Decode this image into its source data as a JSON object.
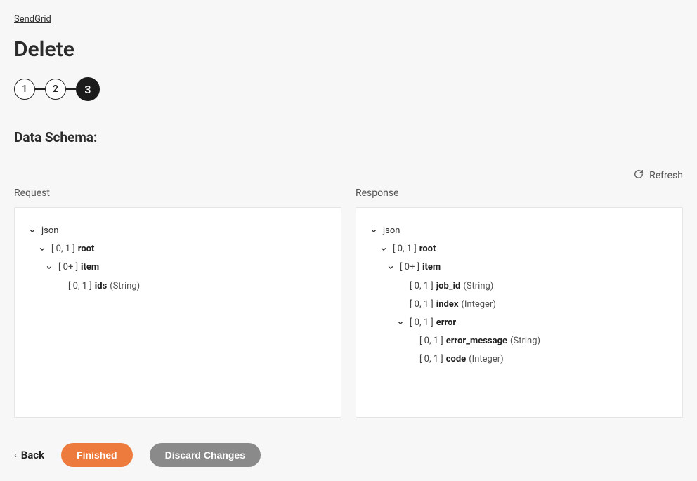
{
  "breadcrumb": {
    "label": "SendGrid"
  },
  "page": {
    "title": "Delete"
  },
  "stepper": {
    "steps": [
      "1",
      "2",
      "3"
    ],
    "activeIndex": 2
  },
  "section": {
    "title": "Data Schema:"
  },
  "refresh": {
    "label": "Refresh"
  },
  "request": {
    "label": "Request",
    "tree": {
      "root_label": "json",
      "nodes": [
        {
          "indent": 1,
          "expandable": true,
          "cardinality": "[ 0, 1 ]",
          "name": "root"
        },
        {
          "indent": 2,
          "expandable": true,
          "cardinality": "[ 0+ ]",
          "name": "item"
        },
        {
          "indent": 3,
          "expandable": false,
          "cardinality": "[ 0, 1 ]",
          "name": "ids",
          "type": "(String)"
        }
      ]
    }
  },
  "response": {
    "label": "Response",
    "tree": {
      "root_label": "json",
      "nodes": [
        {
          "indent": 1,
          "expandable": true,
          "cardinality": "[ 0, 1 ]",
          "name": "root"
        },
        {
          "indent": 2,
          "expandable": true,
          "cardinality": "[ 0+ ]",
          "name": "item"
        },
        {
          "indent": 3,
          "expandable": false,
          "cardinality": "[ 0, 1 ]",
          "name": "job_id",
          "type": "(String)"
        },
        {
          "indent": 3,
          "expandable": false,
          "cardinality": "[ 0, 1 ]",
          "name": "index",
          "type": "(Integer)"
        },
        {
          "indent": 3,
          "expandable": true,
          "cardinality": "[ 0, 1 ]",
          "name": "error"
        },
        {
          "indent": 4,
          "expandable": false,
          "cardinality": "[ 0, 1 ]",
          "name": "error_message",
          "type": "(String)"
        },
        {
          "indent": 4,
          "expandable": false,
          "cardinality": "[ 0, 1 ]",
          "name": "code",
          "type": "(Integer)"
        }
      ]
    }
  },
  "footer": {
    "back": "Back",
    "finished": "Finished",
    "discard": "Discard Changes"
  }
}
